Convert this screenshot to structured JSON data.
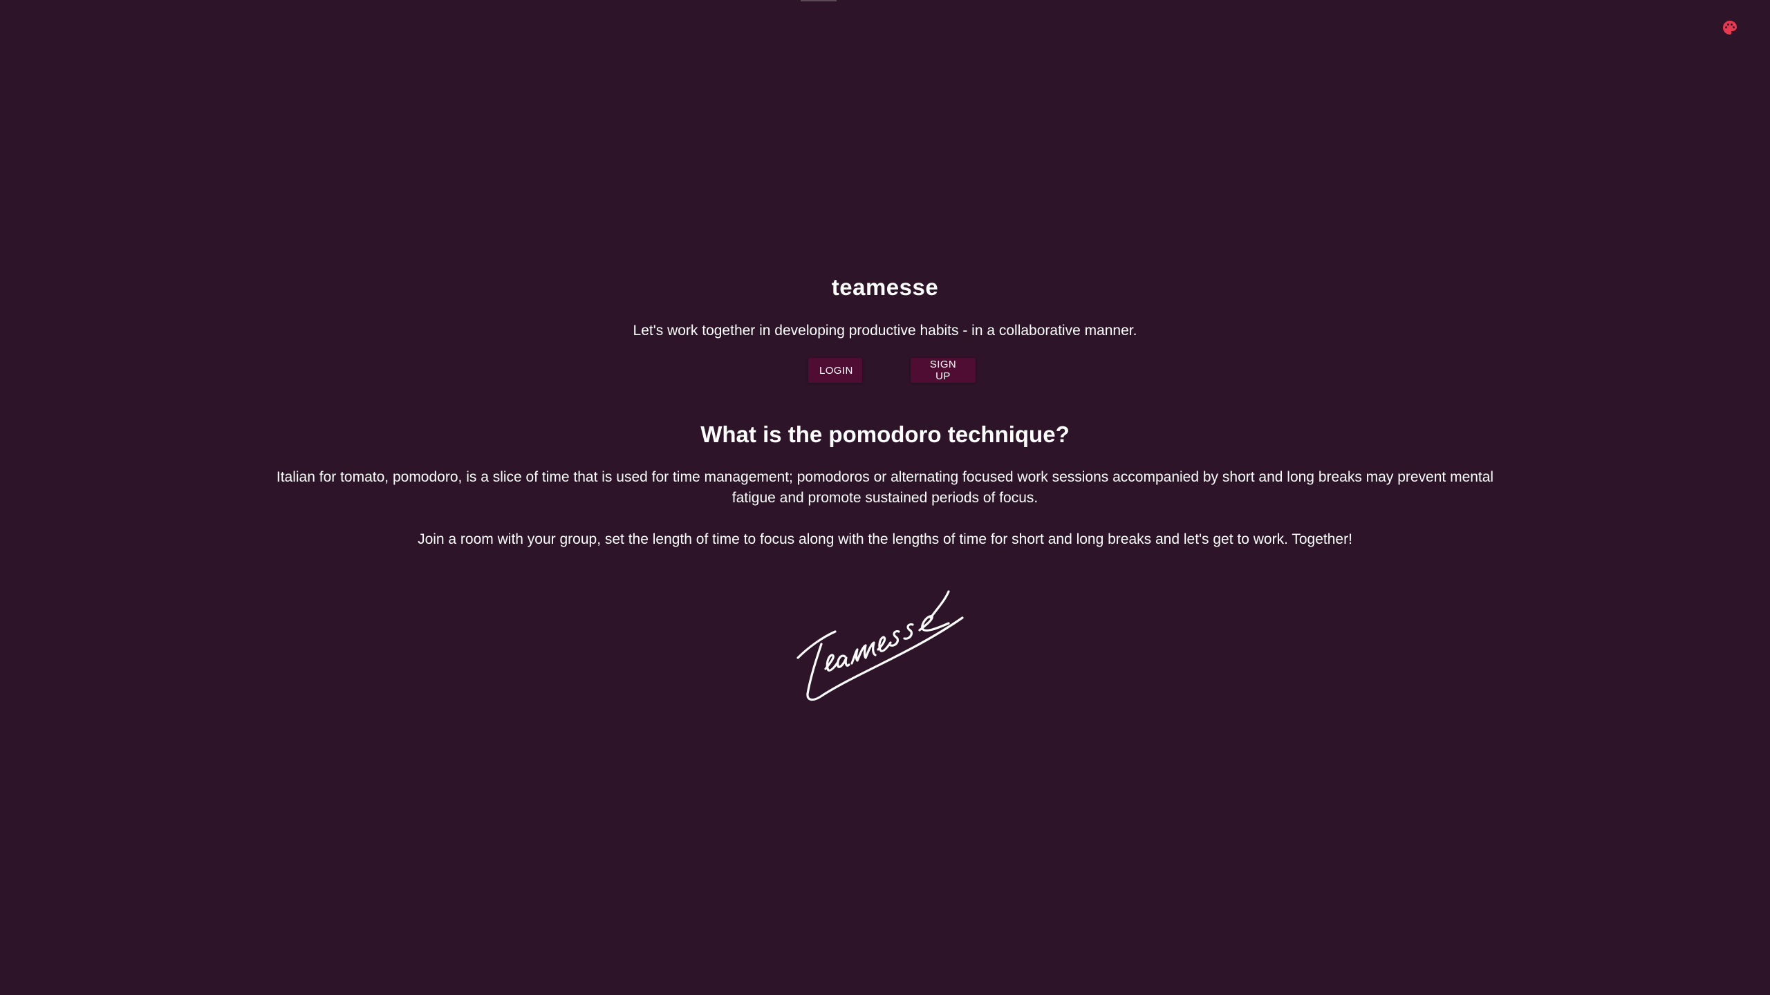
{
  "app": {
    "brand_title": "teamesse",
    "tagline": "Let's work together in developing productive habits - in a collaborative manner."
  },
  "auth": {
    "login_label": "LOGIN",
    "signup_label": "SIGN UP"
  },
  "about": {
    "heading": "What is the pomodoro technique?",
    "paragraph1": "Italian for tomato, pomodoro, is a slice of time that is used for time management; pomodoros or alternating focused work sessions accompanied by short and long breaks may prevent mental fatigue and promote sustained periods of focus.",
    "paragraph2": "Join a room with your group, set the length of time to focus along with the lengths of time for short and long breaks and let's get to work. Together!"
  },
  "logo": {
    "signature_text": "Teamesse",
    "icon": "signature-logo"
  },
  "toolbar": {
    "theme_icon": "palette-icon"
  },
  "colors": {
    "background": "#2d1429",
    "button": "#4f0d33",
    "accent": "#e8384f",
    "text": "#ffffff"
  }
}
